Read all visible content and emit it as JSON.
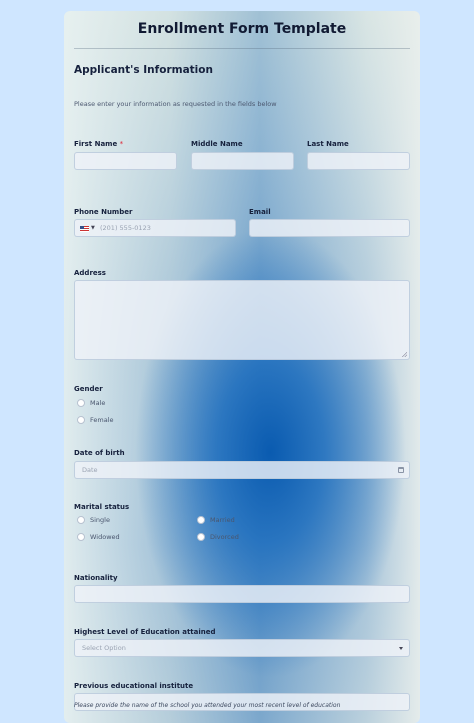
{
  "form": {
    "title": "Enrollment Form Template",
    "section_title": "Applicant's Information",
    "description": "Please enter your information as requested in the fields below"
  },
  "fields": {
    "first_name": {
      "label": "First Name",
      "required_mark": "*",
      "value": ""
    },
    "middle_name": {
      "label": "Middle Name",
      "value": ""
    },
    "last_name": {
      "label": "Last Name",
      "value": ""
    },
    "phone": {
      "label": "Phone Number",
      "placeholder": "(201) 555-0123",
      "country_flag": "us-flag-icon"
    },
    "email": {
      "label": "Email",
      "value": ""
    },
    "address": {
      "label": "Address",
      "value": ""
    },
    "gender": {
      "label": "Gender",
      "options": [
        "Male",
        "Female"
      ]
    },
    "dob": {
      "label": "Date of birth",
      "placeholder": "Date"
    },
    "marital": {
      "label": "Marital status",
      "options": [
        "Single",
        "Married",
        "Widowed",
        "Divorced"
      ]
    },
    "nationality": {
      "label": "Nationality",
      "value": ""
    },
    "education": {
      "label": "Highest Level of Education attained",
      "placeholder": "Select Option"
    },
    "prev_institute": {
      "label": "Previous educational institute",
      "value": "",
      "hint": "Please provide the name of the school you attended your most recent level of education"
    }
  }
}
